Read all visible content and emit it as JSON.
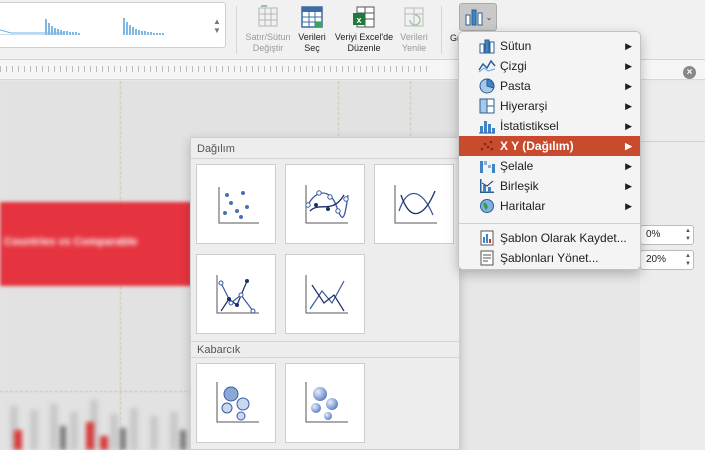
{
  "ribbon": {
    "switch_row_col_label": "Satır/Sütun Değiştir",
    "select_data_label": "Verileri Seç",
    "edit_excel_label": "Veriyi Excel'de Düzenle",
    "refresh_label": "Verileri Yenile",
    "chart_type_label": "Gr"
  },
  "menu": {
    "items": [
      {
        "label": "Sütun",
        "icon": "column-chart-icon"
      },
      {
        "label": "Çizgi",
        "icon": "line-chart-icon"
      },
      {
        "label": "Pasta",
        "icon": "pie-chart-icon"
      },
      {
        "label": "Hiyerarşi",
        "icon": "hierarchy-chart-icon"
      },
      {
        "label": "İstatistiksel",
        "icon": "statistical-chart-icon"
      },
      {
        "label": "X Y (Dağılım)",
        "icon": "scatter-chart-icon"
      },
      {
        "label": "Şelale",
        "icon": "waterfall-chart-icon"
      },
      {
        "label": "Birleşik",
        "icon": "combo-chart-icon"
      },
      {
        "label": "Haritalar",
        "icon": "map-chart-icon"
      }
    ],
    "active_index": 5,
    "actions": [
      {
        "label": "Şablon Olarak Kaydet...",
        "icon": "save-template-icon"
      },
      {
        "label": "Şablonları Yönet...",
        "icon": "manage-templates-icon"
      }
    ],
    "accent_color": "#c84b2e"
  },
  "gallery": {
    "scatter_title": "Dağılım",
    "bubble_title": "Kabarcık"
  },
  "canvas": {
    "banner_text": "Countries vs Comparable",
    "banner_color": "#e5343f"
  },
  "format_pane": {
    "field1_value": "0%",
    "field2_value": "20%"
  }
}
